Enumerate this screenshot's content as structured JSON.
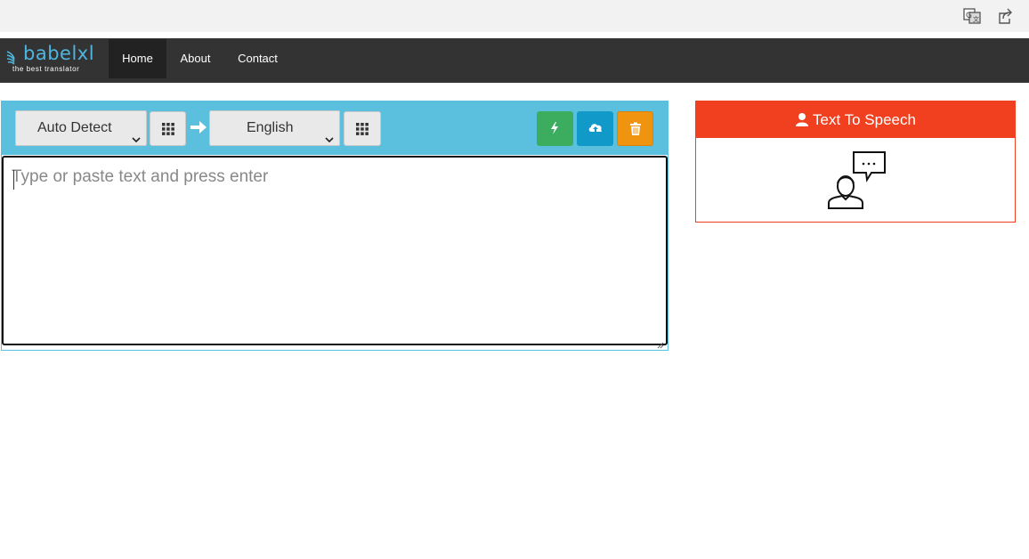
{
  "browser": {
    "icons": [
      "translate-icon",
      "share-icon"
    ]
  },
  "navbar": {
    "logo_word": "babelxl",
    "logo_tagline": "the best translator",
    "items": [
      {
        "label": "Home",
        "active": true
      },
      {
        "label": "About",
        "active": false
      },
      {
        "label": "Contact",
        "active": false
      }
    ],
    "bg_color": "#333333"
  },
  "translator": {
    "source_language": "Auto Detect",
    "target_language": "English",
    "input_placeholder": "Type or paste text and press enter",
    "input_value": "",
    "toolbar_color": "#5bc0de",
    "actions": [
      {
        "icon": "bolt-icon",
        "color": "#3cad5e"
      },
      {
        "icon": "cloud-upload-icon",
        "color": "#1199c9"
      },
      {
        "icon": "trash-icon",
        "color": "#f0930e"
      }
    ]
  },
  "tts": {
    "title": "Text To Speech",
    "header_color": "#f0401f"
  }
}
